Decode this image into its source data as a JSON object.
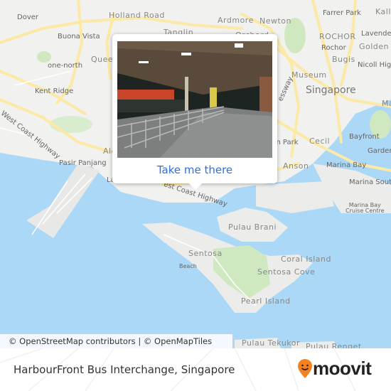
{
  "map": {
    "labels": {
      "dover": "Dover",
      "holland_road": "Holland Road",
      "tanglin": "Tanglin",
      "ardmore": "Ardmore",
      "newton": "Newton",
      "orchard": "Orchard",
      "farrer_park": "Farrer Park",
      "kallang": "Kalla",
      "buona_vista": "Buona Vista",
      "rochor_upper": "ROCHOR",
      "lavender": "Lavender",
      "rochor": "Rochor",
      "golden_mile": "Golden M",
      "queenstown": "Queen",
      "one_north": "one-north",
      "bugis": "Bugis",
      "nicoll_highway": "Nicoll Highw",
      "museum": "Museum",
      "singapore": "Singapore",
      "kent_ridge": "Kent Ridge",
      "west_coast_highway": "West Coast Highway",
      "expressway": "essway",
      "marina_east": "Ma",
      "bayfront": "Bayfront",
      "alexandra": "Ale",
      "cecil": "Cecil",
      "tanjong_park": "m Park",
      "gardens": "Gardens",
      "pasir_panjang": "Pasir Panjang",
      "anson": "Anson",
      "marina_bay": "Marina Bay",
      "marina_south": "Marina South P",
      "labrador": "La",
      "west_coast_highway_2": "est Coast Highway",
      "marina_bay_cruise": "Marina Bay\nCruise Centre",
      "pulau_brani": "Pulau Brani",
      "sentosa": "Sentosa",
      "coral_island": "Coral Island",
      "beach": "Beach",
      "sentosa_cove": "Sentosa Cove",
      "pearl_island": "Pearl Island",
      "pulau_tekukor": "Pulau Tekukor",
      "pulau_renget": "Pulau Renget"
    },
    "attribution": "© OpenStreetMap contributors | © OpenMapTiles",
    "colors": {
      "land": "#f1f1ef",
      "water": "#abd8f7",
      "road": "#fce9a6",
      "park": "#cfe8c0"
    }
  },
  "popup": {
    "photo_alt": "HarbourFront Bus Interchange",
    "cta_label": "Take me there",
    "cta_color": "#2f6fde"
  },
  "footer": {
    "place_title": "HarbourFront Bus Interchange, Singapore",
    "brand": "moovit",
    "brand_color": "#f5821f"
  }
}
